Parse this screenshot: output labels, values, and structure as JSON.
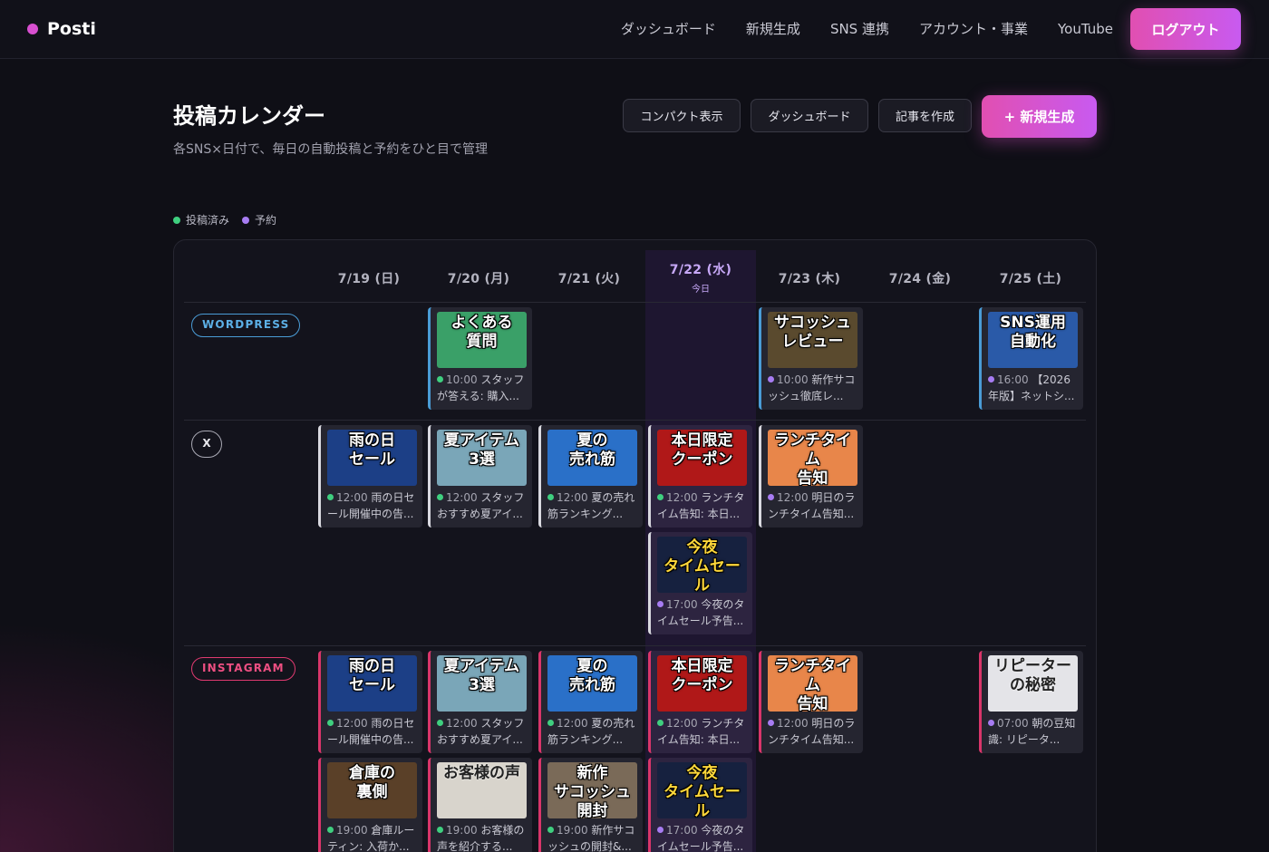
{
  "app": {
    "name": "Posti"
  },
  "nav": {
    "links": [
      "ダッシュボード",
      "新規生成",
      "SNS 連携",
      "アカウント・事業",
      "YouTube"
    ],
    "logout": "ログアウト"
  },
  "header": {
    "title": "投稿カレンダー",
    "subtitle": "各SNS×日付で、毎日の自動投稿と予約をひと目で管理",
    "btn_compact": "コンパクト表示",
    "btn_dashboard": "ダッシュボード",
    "btn_article": "記事を作成",
    "btn_new": "+ 新規生成"
  },
  "legend": [
    {
      "label": "投稿済み",
      "color": "#3fcf7f"
    },
    {
      "label": "予約",
      "color": "#a77cf2"
    }
  ],
  "calendar": {
    "days": [
      "7/19 (日)",
      "7/20 (月)",
      "7/21 (火)",
      "7/22 (水)",
      "7/23 (木)",
      "7/24 (金)",
      "7/25 (土)"
    ],
    "today_index": 3,
    "today_label": "今日",
    "platforms": {
      "wordpress": "WORDPRESS",
      "x": "X",
      "instagram": "INSTAGRAM"
    },
    "posts": {
      "wordpress": [
        {
          "day": 1,
          "time": "10:00",
          "caption": "スタッフが答える: 購入...",
          "thumb": "よくある\n質問",
          "bg": "#3aa068",
          "status": "posted"
        },
        {
          "day": 4,
          "time": "10:00",
          "caption": "新作サコッシュ徹底レ...",
          "thumb": "サコッシュ\nレビュー",
          "bg": "#5a4a2e",
          "status": "scheduled"
        },
        {
          "day": 6,
          "time": "16:00",
          "caption": "【2026年版】ネットシ...",
          "thumb": "SNS運用\n自動化",
          "bg": "#2a5aa8",
          "status": "scheduled"
        }
      ],
      "x": [
        {
          "day": 0,
          "time": "12:00",
          "caption": "雨の日セール開催中の告...",
          "thumb": "雨の日\nセール",
          "bg": "#1c3f86",
          "status": "posted"
        },
        {
          "day": 1,
          "time": "12:00",
          "caption": "スタッフおすすめ夏アイ...",
          "thumb": "夏アイテム\n3選",
          "bg": "#7aa6b8",
          "status": "posted"
        },
        {
          "day": 2,
          "time": "12:00",
          "caption": "夏の売れ筋ランキング...",
          "thumb": "夏の\n売れ筋",
          "bg": "#2a70c8",
          "status": "posted"
        },
        {
          "day": 3,
          "time": "12:00",
          "caption": "ランチタイム告知: 本日...",
          "thumb": "本日限定\nクーポン",
          "bg": "#b01818",
          "status": "posted"
        },
        {
          "day": 3,
          "time": "17:00",
          "caption": "今夜のタイムセール予告...",
          "thumb": "今夜\nタイムセール",
          "bg": "#16213f",
          "status": "scheduled",
          "second": true,
          "yellow": true
        },
        {
          "day": 4,
          "time": "12:00",
          "caption": "明日のランチタイム告知...",
          "thumb": "ランチタイム\n告知",
          "bg": "#e8864a",
          "status": "scheduled"
        }
      ],
      "instagram": [
        {
          "day": 0,
          "time": "12:00",
          "caption": "雨の日セール開催中の告...",
          "thumb": "雨の日\nセール",
          "bg": "#1c3f86",
          "status": "posted"
        },
        {
          "day": 1,
          "time": "12:00",
          "caption": "スタッフおすすめ夏アイ...",
          "thumb": "夏アイテム\n3選",
          "bg": "#7aa6b8",
          "status": "posted"
        },
        {
          "day": 2,
          "time": "12:00",
          "caption": "夏の売れ筋ランキング...",
          "thumb": "夏の\n売れ筋",
          "bg": "#2a70c8",
          "status": "posted"
        },
        {
          "day": 3,
          "time": "12:00",
          "caption": "ランチタイム告知: 本日...",
          "thumb": "本日限定\nクーポン",
          "bg": "#b01818",
          "status": "posted"
        },
        {
          "day": 4,
          "time": "12:00",
          "caption": "明日のランチタイム告知...",
          "thumb": "ランチタイム\n告知",
          "bg": "#e8864a",
          "status": "scheduled"
        },
        {
          "day": 6,
          "time": "07:00",
          "caption": "朝の豆知識: リピータ...",
          "thumb": "リピーター\nの秘密",
          "bg": "#e4e4e8",
          "status": "scheduled",
          "dark": true
        },
        {
          "day": 0,
          "time": "19:00",
          "caption": "倉庫ルーティン: 入荷か...",
          "thumb": "倉庫の\n裏側",
          "bg": "#5a4028",
          "status": "posted",
          "second": true
        },
        {
          "day": 1,
          "time": "19:00",
          "caption": "お客様の声を紹介する...",
          "thumb": "お客様の声",
          "bg": "#d8d4cc",
          "status": "posted",
          "second": true,
          "dark": true
        },
        {
          "day": 2,
          "time": "19:00",
          "caption": "新作サコッシュの開封&...",
          "thumb": "新作\nサコッシュ\n開封",
          "bg": "#7a6a58",
          "status": "posted",
          "second": true
        },
        {
          "day": 3,
          "time": "17:00",
          "caption": "今夜のタイムセール予告...",
          "thumb": "今夜\nタイムセール",
          "bg": "#16213f",
          "status": "scheduled",
          "second": true,
          "yellow": true
        }
      ]
    }
  },
  "colors": {
    "accent": "#d84fd0",
    "posted": "#3fcf7f",
    "scheduled": "#a77cf2",
    "wordpress": "#4a9cd6",
    "instagram": "#e03a70"
  }
}
